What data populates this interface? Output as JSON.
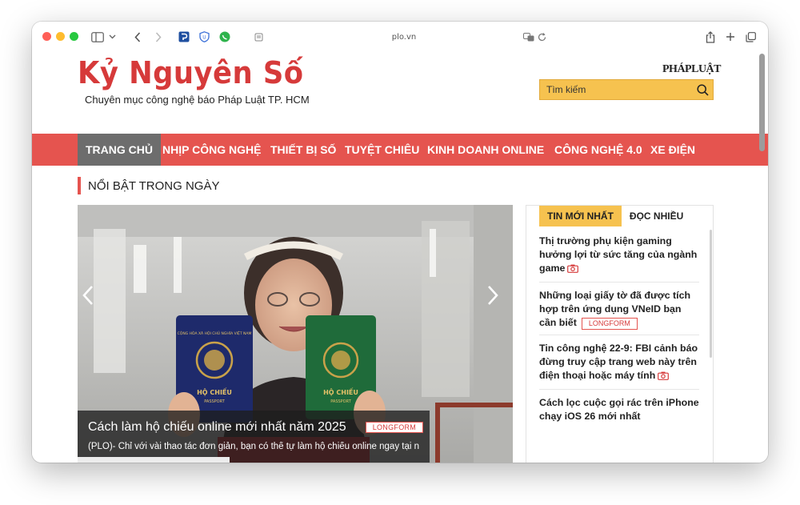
{
  "browser": {
    "address": "plo.vn",
    "colors": {
      "close": "#ff5f57",
      "minimize": "#febc2e",
      "zoom": "#28c840"
    }
  },
  "site": {
    "logo_title": "Kỷ Nguyên Số",
    "tagline": "Chuyên mục công nghệ báo Pháp Luật TP. HCM",
    "partner_logo": "PHÁPLUẬT",
    "search_placeholder": "Tìm kiếm",
    "accent_color": "#e5544f",
    "highlight_color": "#f6c24f"
  },
  "nav": {
    "items": [
      {
        "label": "TRANG CHỦ",
        "active": true
      },
      {
        "label": "NHỊP CÔNG NGHỆ"
      },
      {
        "label": "THIẾT BỊ SỐ"
      },
      {
        "label": "TUYỆT CHIÊU"
      },
      {
        "label": "KINH DOANH ONLINE"
      },
      {
        "label": "CÔNG NGHỆ 4.0"
      },
      {
        "label": "XE ĐIỆN"
      }
    ]
  },
  "featured": {
    "section_title": "NỔI BẬT TRONG NGÀY",
    "headline": "Cách làm hộ chiếu online mới nhất năm 2025",
    "badge": "LONGFORM",
    "description": "(PLO)- Chỉ với vài thao tác đơn giản, bạn có thể tự làm hộ chiếu online ngay tại nhà,...",
    "passport_blue_label": "HỘ CHIẾU",
    "passport_blue_sub": "PASSPORT",
    "passport_green_label": "HỘ CHIẾU",
    "passport_green_sub": "PASSPORT"
  },
  "sidebar": {
    "tabs": [
      {
        "label": "TIN MỚI NHẤT",
        "active": true
      },
      {
        "label": "ĐỌC NHIỀU"
      }
    ],
    "news": [
      {
        "text": "Thị trường phụ kiện gaming hưởng lợi từ sức tăng của ngành game",
        "camera": true
      },
      {
        "text": "Những loại giấy tờ đã được tích hợp trên ứng dụng VNeID bạn cần biết",
        "badge": "LONGFORM"
      },
      {
        "text": "Tin công nghệ 22-9: FBI cảnh báo đừng truy cập trang web này trên điện thoại hoặc máy tính",
        "camera": true
      },
      {
        "text": "Cách lọc cuộc gọi rác trên iPhone chạy iOS 26 mới nhất"
      }
    ]
  }
}
